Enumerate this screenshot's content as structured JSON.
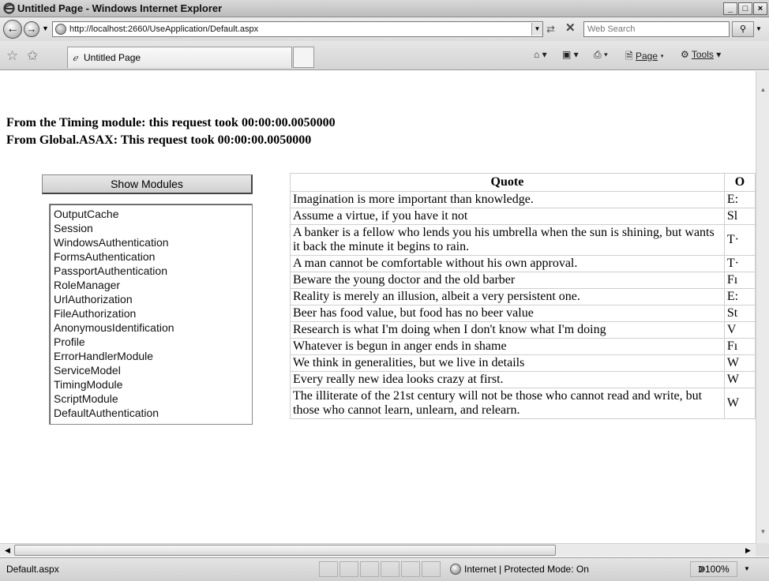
{
  "window": {
    "title": "Untitled Page - Windows Internet Explorer",
    "minimize": "_",
    "maximize": "□",
    "close": "×"
  },
  "address": {
    "url": "http://localhost:2660/UseApplication/Default.aspx",
    "search_placeholder": "Web Search"
  },
  "tabs": [
    {
      "label": "Untitled Page"
    }
  ],
  "commands": {
    "page": "Page",
    "tools": "Tools"
  },
  "page": {
    "timing_module": "From the Timing module: this request took 00:00:00.0050000",
    "timing_global": "From Global.ASAX: This request took 00:00:00.0050000",
    "show_modules_button": "Show Modules",
    "modules": [
      "OutputCache",
      "Session",
      "WindowsAuthentication",
      "FormsAuthentication",
      "PassportAuthentication",
      "RoleManager",
      "UrlAuthorization",
      "FileAuthorization",
      "AnonymousIdentification",
      "Profile",
      "ErrorHandlerModule",
      "ServiceModel",
      "TimingModule",
      "ScriptModule",
      "DefaultAuthentication"
    ],
    "table": {
      "headers": [
        "Quote",
        "O"
      ],
      "rows": [
        {
          "quote": "Imagination is more important than knowledge.",
          "author": "E:"
        },
        {
          "quote": "Assume a virtue, if you have it not",
          "author": "Sl"
        },
        {
          "quote": "A banker is a fellow who lends you his umbrella when the sun is shining, but wants it back the minute it begins to rain.",
          "author": "T·"
        },
        {
          "quote": "A man cannot be comfortable without his own approval.",
          "author": "T·"
        },
        {
          "quote": "Beware the young doctor and the old barber",
          "author": "Fı"
        },
        {
          "quote": "Reality is merely an illusion, albeit a very persistent one.",
          "author": "E:"
        },
        {
          "quote": "Beer has food value, but food has no beer value",
          "author": "St"
        },
        {
          "quote": "Research is what I'm doing when I don't know what I'm doing",
          "author": "V"
        },
        {
          "quote": "Whatever is begun in anger ends in shame",
          "author": "Fı"
        },
        {
          "quote": "We think in generalities, but we live in details",
          "author": "W"
        },
        {
          "quote": "Every really new idea looks crazy at first.",
          "author": "W"
        },
        {
          "quote": "The illiterate of the 21st century will not be those who cannot read and write, but those who cannot learn, unlearn, and relearn.",
          "author": "W"
        }
      ]
    }
  },
  "status": {
    "text": "Default.aspx",
    "zone": "Internet | Protected Mode: On",
    "zoom": "ↇ100%"
  }
}
